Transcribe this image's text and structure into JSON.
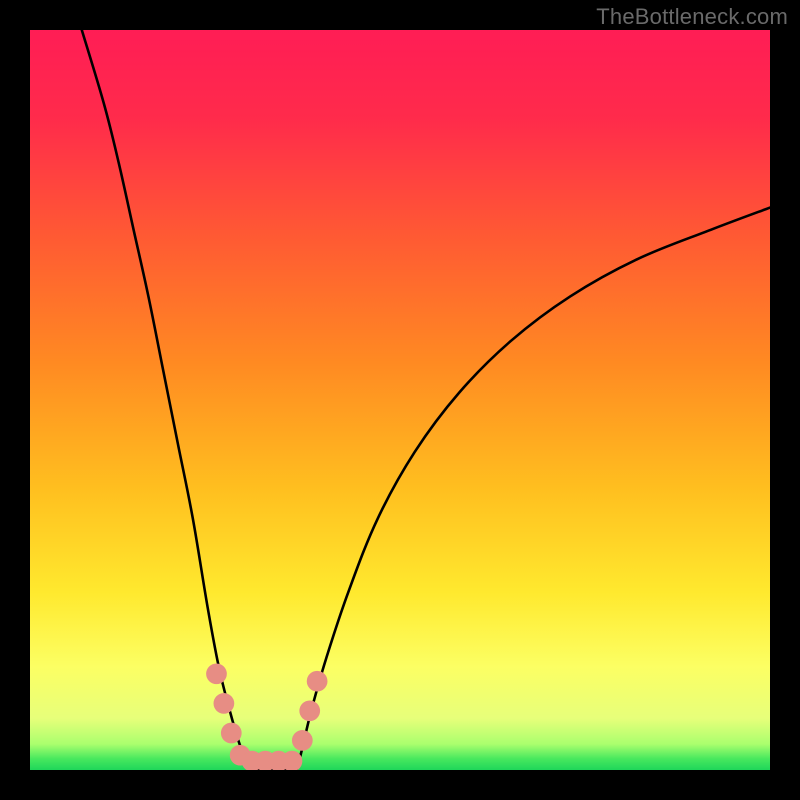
{
  "watermark": "TheBottleneck.com",
  "chart_data": {
    "type": "line",
    "title": "",
    "xlabel": "",
    "ylabel": "",
    "xlim": [
      0,
      100
    ],
    "ylim": [
      0,
      100
    ],
    "grid": false,
    "legend": false,
    "series": [
      {
        "name": "left-curve",
        "x": [
          7,
          10,
          12,
          14,
          16,
          18,
          20,
          22,
          24,
          25.5,
          27,
          28.5,
          30
        ],
        "y": [
          100,
          90,
          82,
          73,
          64,
          54,
          44,
          34,
          22,
          14,
          8,
          3,
          0
        ]
      },
      {
        "name": "valley-floor",
        "x": [
          30,
          31,
          32,
          33,
          34,
          35,
          36
        ],
        "y": [
          0,
          0,
          0,
          0,
          0,
          0,
          0
        ]
      },
      {
        "name": "right-curve",
        "x": [
          36,
          38,
          40,
          43,
          47,
          52,
          58,
          65,
          73,
          82,
          92,
          100
        ],
        "y": [
          0,
          8,
          15,
          24,
          34,
          43,
          51,
          58,
          64,
          69,
          73,
          76
        ]
      },
      {
        "name": "green-band",
        "x": [
          0,
          100
        ],
        "y": [
          1.5,
          1.5
        ]
      }
    ],
    "markers": [
      {
        "name": "left-dot-1",
        "x": 25.2,
        "y": 13,
        "r": 1.4,
        "color": "#e78d84"
      },
      {
        "name": "left-dot-2",
        "x": 26.2,
        "y": 9,
        "r": 1.4,
        "color": "#e78d84"
      },
      {
        "name": "left-dot-3",
        "x": 27.2,
        "y": 5,
        "r": 1.4,
        "color": "#e78d84"
      },
      {
        "name": "left-dot-4",
        "x": 28.4,
        "y": 2,
        "r": 1.4,
        "color": "#e78d84"
      },
      {
        "name": "floor-dot-1",
        "x": 30.0,
        "y": 1.2,
        "r": 1.4,
        "color": "#e78d84"
      },
      {
        "name": "floor-dot-2",
        "x": 31.8,
        "y": 1.2,
        "r": 1.4,
        "color": "#e78d84"
      },
      {
        "name": "floor-dot-3",
        "x": 33.6,
        "y": 1.2,
        "r": 1.4,
        "color": "#e78d84"
      },
      {
        "name": "floor-dot-4",
        "x": 35.4,
        "y": 1.2,
        "r": 1.4,
        "color": "#e78d84"
      },
      {
        "name": "right-dot-1",
        "x": 36.8,
        "y": 4,
        "r": 1.4,
        "color": "#e78d84"
      },
      {
        "name": "right-dot-2",
        "x": 37.8,
        "y": 8,
        "r": 1.4,
        "color": "#e78d84"
      },
      {
        "name": "right-dot-3",
        "x": 38.8,
        "y": 12,
        "r": 1.4,
        "color": "#e78d84"
      }
    ],
    "gradient_stops": [
      {
        "offset": 0,
        "color": "#ff1d55"
      },
      {
        "offset": 0.12,
        "color": "#ff2b4b"
      },
      {
        "offset": 0.28,
        "color": "#ff5a33"
      },
      {
        "offset": 0.45,
        "color": "#ff8a22"
      },
      {
        "offset": 0.62,
        "color": "#ffbf1f"
      },
      {
        "offset": 0.76,
        "color": "#ffe92e"
      },
      {
        "offset": 0.86,
        "color": "#fcff63"
      },
      {
        "offset": 0.93,
        "color": "#e7ff7a"
      },
      {
        "offset": 0.965,
        "color": "#aaff6e"
      },
      {
        "offset": 0.985,
        "color": "#47e85e"
      },
      {
        "offset": 1.0,
        "color": "#1fd65a"
      }
    ]
  }
}
